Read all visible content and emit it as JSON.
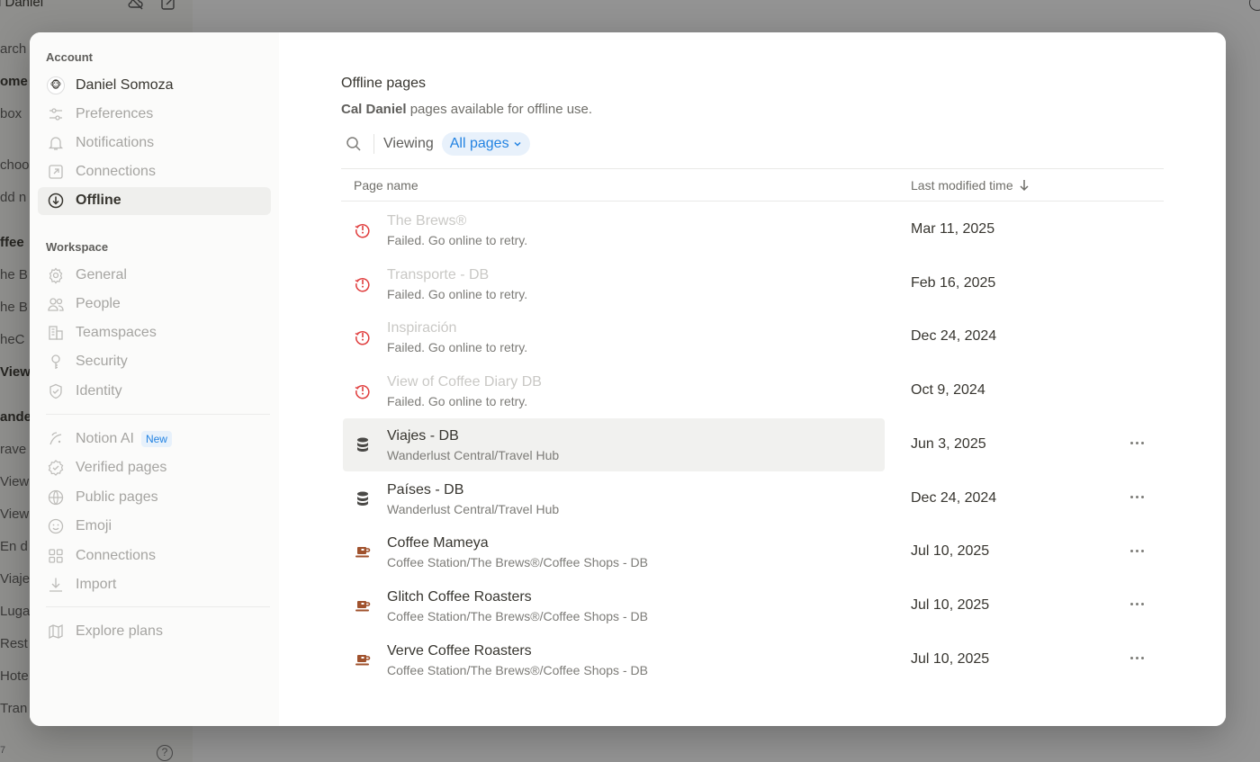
{
  "background": {
    "workspace_name": "l Daniel",
    "sidebar_fragments": [
      "arch",
      "ome",
      "box",
      "choo",
      "dd n",
      "ffee",
      "he B",
      "he B",
      "heC",
      "View",
      "ande",
      "rave",
      "View",
      "View",
      "En d",
      "Viaje",
      "Luga",
      "Rest",
      "Hote",
      "Tran"
    ],
    "version_fragment": "7"
  },
  "modal": {
    "sidebar": {
      "account_heading": "Account",
      "user_name": "Daniel Somoza",
      "account_items": [
        {
          "label": "Preferences",
          "icon": "sliders-icon"
        },
        {
          "label": "Notifications",
          "icon": "bell-icon"
        },
        {
          "label": "Connections",
          "icon": "arrow-box-icon"
        },
        {
          "label": "Offline",
          "icon": "download-circle-icon",
          "active": true
        }
      ],
      "workspace_heading": "Workspace",
      "workspace_items": [
        {
          "label": "General",
          "icon": "gear-icon"
        },
        {
          "label": "People",
          "icon": "people-icon"
        },
        {
          "label": "Teamspaces",
          "icon": "building-icon"
        },
        {
          "label": "Security",
          "icon": "key-icon"
        },
        {
          "label": "Identity",
          "icon": "shield-check-icon"
        }
      ],
      "feature_items": [
        {
          "label": "Notion AI",
          "icon": "notion-ai-icon",
          "badge": "New"
        },
        {
          "label": "Verified pages",
          "icon": "verified-icon"
        },
        {
          "label": "Public pages",
          "icon": "globe-icon"
        },
        {
          "label": "Emoji",
          "icon": "smiley-icon"
        },
        {
          "label": "Connections",
          "icon": "grid-icon"
        },
        {
          "label": "Import",
          "icon": "import-icon"
        }
      ],
      "explore_plans": "Explore plans"
    },
    "main": {
      "title": "Offline pages",
      "subtitle_bold": "Cal Daniel",
      "subtitle_rest": " pages available for offline use.",
      "viewing_label": "Viewing",
      "filter_value": "All pages",
      "col_name": "Page name",
      "col_time": "Last modified time",
      "rows": [
        {
          "name": "The Brews®",
          "path": "Failed. Go online to retry.",
          "date": "Mar 11, 2025",
          "status": "failed"
        },
        {
          "name": "Transporte - DB",
          "path": "Failed. Go online to retry.",
          "date": "Feb 16, 2025",
          "status": "failed"
        },
        {
          "name": "Inspiración",
          "path": "Failed. Go online to retry.",
          "date": "Dec 24, 2024",
          "status": "failed"
        },
        {
          "name": "View of Coffee Diary DB",
          "path": "Failed. Go online to retry.",
          "date": "Oct 9, 2024",
          "status": "failed"
        },
        {
          "name": "Viajes - DB",
          "path": "Wanderlust Central/Travel Hub",
          "date": "Jun 3, 2025",
          "status": "database"
        },
        {
          "name": "Países - DB",
          "path": "Wanderlust Central/Travel Hub",
          "date": "Dec 24, 2024",
          "status": "database"
        },
        {
          "name": "Coffee Mameya",
          "path": "Coffee Station/The Brews®/Coffee Shops - DB",
          "date": "Jul 10, 2025",
          "status": "coffee"
        },
        {
          "name": "Glitch Coffee Roasters",
          "path": "Coffee Station/The Brews®/Coffee Shops - DB",
          "date": "Jul 10, 2025",
          "status": "coffee"
        },
        {
          "name": "Verve Coffee Roasters",
          "path": "Coffee Station/The Brews®/Coffee Shops - DB",
          "date": "Jul 10, 2025",
          "status": "coffee"
        }
      ]
    }
  },
  "colors": {
    "accent": "#2383e2",
    "error": "#e03e3e",
    "coffee": "#a0522d"
  }
}
